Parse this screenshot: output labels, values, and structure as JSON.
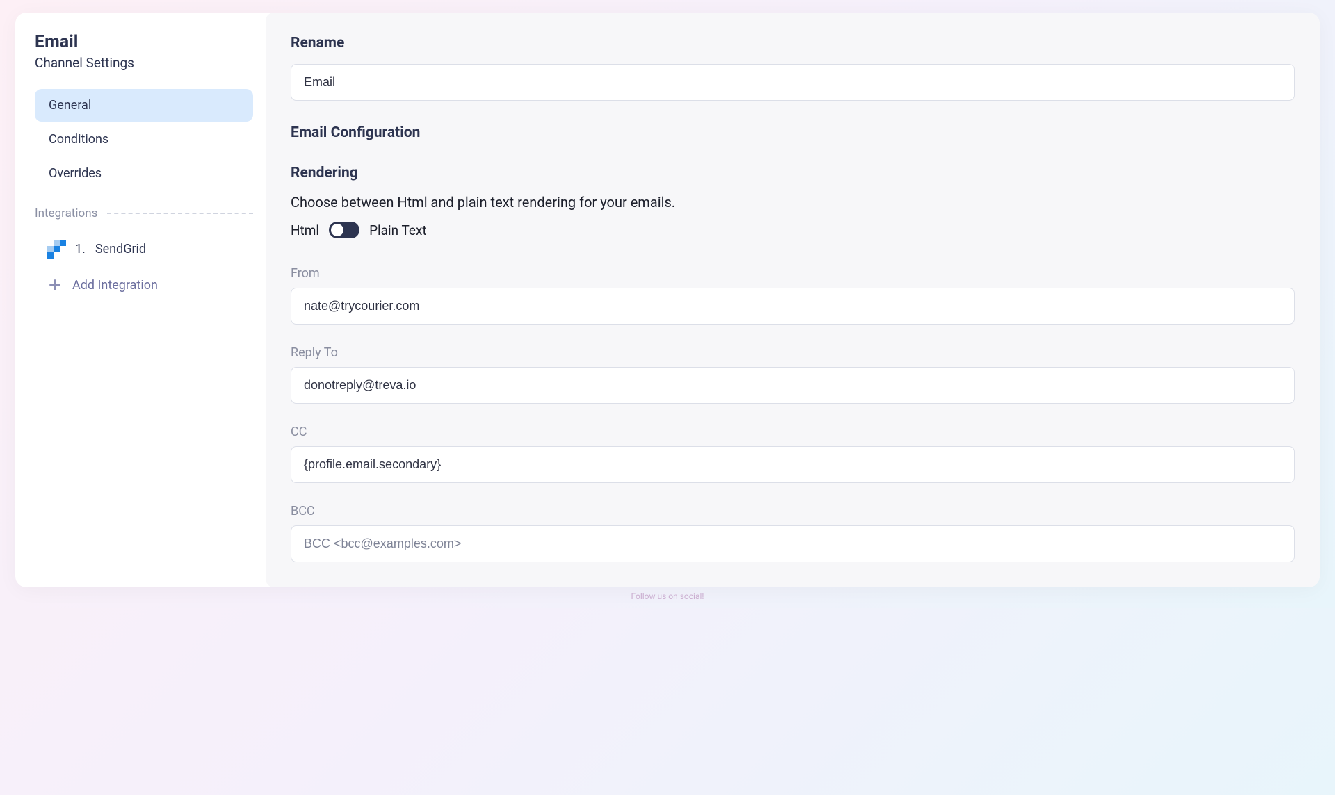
{
  "sidebar": {
    "title": "Email",
    "subtitle": "Channel Settings",
    "nav": [
      {
        "label": "General",
        "active": true
      },
      {
        "label": "Conditions",
        "active": false
      },
      {
        "label": "Overrides",
        "active": false
      }
    ],
    "integrations_label": "Integrations",
    "integrations": [
      {
        "index": "1.",
        "name": "SendGrid"
      }
    ],
    "add_integration_label": "Add Integration"
  },
  "main": {
    "rename": {
      "title": "Rename",
      "value": "Email"
    },
    "config_title": "Email Configuration",
    "rendering": {
      "title": "Rendering",
      "helper": "Choose between Html and plain text rendering for your emails.",
      "left_label": "Html",
      "right_label": "Plain Text"
    },
    "fields": {
      "from": {
        "label": "From",
        "value": "nate@trycourier.com",
        "placeholder": ""
      },
      "reply": {
        "label": "Reply To",
        "value": "donotreply@treva.io",
        "placeholder": ""
      },
      "cc": {
        "label": "CC",
        "value": "{profile.email.secondary}",
        "placeholder": ""
      },
      "bcc": {
        "label": "BCC",
        "value": "",
        "placeholder": "BCC <bcc@examples.com>"
      }
    }
  },
  "footer": "Follow us on social!"
}
